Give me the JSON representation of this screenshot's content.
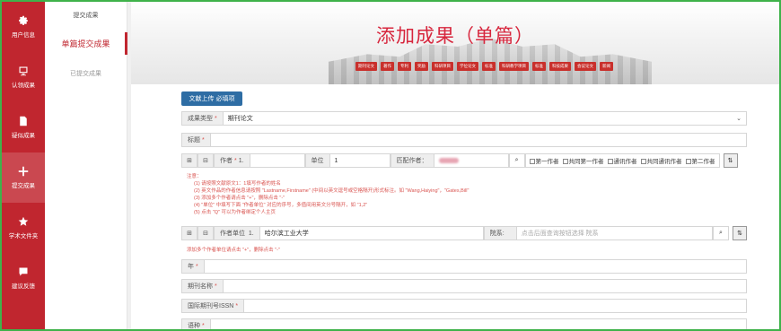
{
  "nav": {
    "items": [
      {
        "label": "用户信息",
        "icon": "gear-icon"
      },
      {
        "label": "认领成果",
        "icon": "monitor-icon"
      },
      {
        "label": "疑似成果",
        "icon": "document-icon"
      },
      {
        "label": "提交成果",
        "icon": "plus-icon"
      },
      {
        "label": "学术文件夹",
        "icon": "star-icon"
      },
      {
        "label": "建议反馈",
        "icon": "chat-icon"
      }
    ]
  },
  "subnav": {
    "header": "提交成果",
    "single": "单篇提交成果",
    "submitted": "已提交成果"
  },
  "banner": {
    "title": "添加成果（单篇）",
    "tags": [
      "期刊论文",
      "著作",
      "专利",
      "奖励",
      "科研项目",
      "学位论文",
      "标准",
      "科研教学项目",
      "标准",
      "科技成果",
      "会议论文",
      "新闻"
    ]
  },
  "upload_button": "文献上传 必填项",
  "form": {
    "type_label": "成果类型",
    "type_value": "期刊论文",
    "title_label": "标题",
    "author_label": "作者",
    "author_num": "1.",
    "unit_label": "单位",
    "unit_value": "1",
    "match_label": "匹配作者：",
    "check_first": "第一作者",
    "check_cofirst": "共同第一作者",
    "check_corr": "通讯作者",
    "check_cocorr": "共同通讯作者",
    "check_second": "第二作者",
    "notes": {
      "head": "注意：",
      "lines": [
        "(1) 请按照文献原文1：1填写作者的姓名",
        "(2) 英文作品的作者信息请按照 \"Lastname,Firstname\" (中间以英文逗号或空格隔开)形式标注。如 \"Wang,Haiying\"，\"Gates,Bill\"",
        "(3) 添加多个作者请点击 \"+\"，删除点击 \"-\"",
        "(4) \"单位\" 中填写下面 \"作者单位\" 对应的序号，多值间用英文分号隔开，如 \"1,2\"",
        "(5) 点击 \"Q\" 可以为作者绑定个人主页"
      ]
    },
    "unit_row_label": "作者单位",
    "unit_row_num": "1.",
    "unit_row_value": "哈尔滨工业大学",
    "dept_label": "院系:",
    "dept_placeholder": "点击后面查询按钮选择 院系",
    "add_unit_note": "添加多个作者单位请点击 \"+\"，删除点击 \"-\"",
    "year_label": "年",
    "journal_label": "期刊名称",
    "issn_label": "国际期刊号ISSN",
    "lang_label": "语种"
  }
}
